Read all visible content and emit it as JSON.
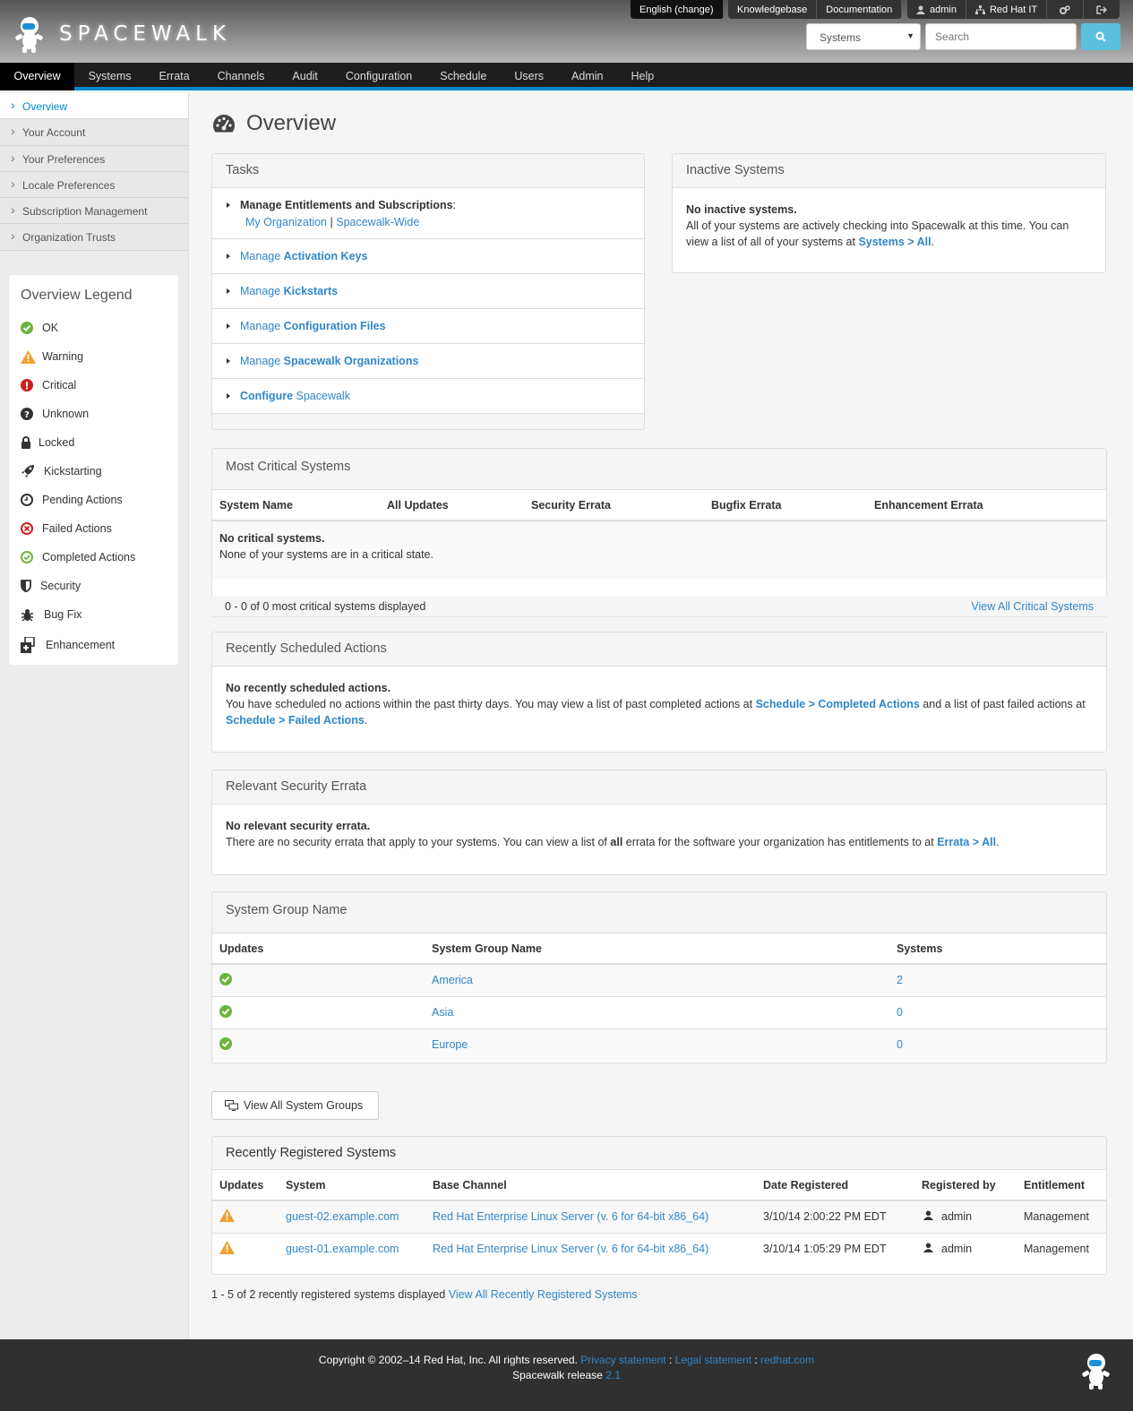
{
  "app": {
    "name": "SPACEWALK"
  },
  "utility": {
    "language": "English (change)",
    "knowledgebase": "Knowledgebase",
    "documentation": "Documentation",
    "user": "admin",
    "org": "Red Hat IT"
  },
  "search": {
    "scope": "Systems",
    "placeholder": "Search"
  },
  "nav": [
    "Overview",
    "Systems",
    "Errata",
    "Channels",
    "Audit",
    "Configuration",
    "Schedule",
    "Users",
    "Admin",
    "Help"
  ],
  "sidebar": [
    "Overview",
    "Your Account",
    "Your Preferences",
    "Locale Preferences",
    "Subscription Management",
    "Organization Trusts"
  ],
  "legend": {
    "title": "Overview Legend",
    "items": [
      "OK",
      "Warning",
      "Critical",
      "Unknown",
      "Locked",
      "Kickstarting",
      "Pending Actions",
      "Failed Actions",
      "Completed Actions",
      "Security",
      "Bug Fix",
      "Enhancement"
    ]
  },
  "page": {
    "title": "Overview"
  },
  "tasks": {
    "title": "Tasks",
    "t1": {
      "bold": "Manage Entitlements and Subscriptions",
      "suffix": ":",
      "link1": "My Organization",
      "sep": "|",
      "link2": "Spacewalk-Wide"
    },
    "t2": {
      "pre": "Manage ",
      "bold": "Activation Keys"
    },
    "t3": {
      "pre": "Manage ",
      "bold": "Kickstarts"
    },
    "t4": {
      "pre": "Manage ",
      "bold": "Configuration Files"
    },
    "t5": {
      "pre": "Manage ",
      "bold": "Spacewalk Organizations"
    },
    "t6": {
      "bold": "Configure",
      "post": " Spacewalk"
    }
  },
  "inactive": {
    "title": "Inactive Systems",
    "heading": "No inactive systems.",
    "text": "All of your systems are actively checking into Spacewalk at this time. You can view a list of all of your systems at ",
    "link": "Systems > All",
    "end": "."
  },
  "critical": {
    "title": "Most Critical Systems",
    "columns": [
      "System Name",
      "All Updates",
      "Security Errata",
      "Bugfix Errata",
      "Enhancement Errata"
    ],
    "empty_heading": "No critical systems.",
    "empty_text": "None of your systems are in a critical state.",
    "footer": "0 - 0 of 0 most critical systems displayed",
    "view_all": "View All Critical Systems"
  },
  "scheduled": {
    "title": "Recently Scheduled Actions",
    "heading": "No recently scheduled actions.",
    "text1": "You have scheduled no actions within the past thirty days. You may view a list of past completed actions at ",
    "link1": "Schedule > Completed Actions",
    "text2": " and a list of past failed actions at ",
    "link2": "Schedule > Failed Actions",
    "end": "."
  },
  "security": {
    "title": "Relevant Security Errata",
    "heading": "No relevant security errata.",
    "text1": "There are no security errata that apply to your systems. You can view a list of ",
    "bold": "all",
    "text2": " errata for the software your organization has entitlements to at ",
    "link": "Errata > All",
    "end": "."
  },
  "groups": {
    "title": "System Group Name",
    "columns": [
      "Updates",
      "System Group Name",
      "Systems"
    ],
    "rows": [
      {
        "name": "America",
        "systems": "2"
      },
      {
        "name": "Asia",
        "systems": "0"
      },
      {
        "name": "Europe",
        "systems": "0"
      }
    ],
    "button": "View All System Groups"
  },
  "registered": {
    "title": "Recently Registered Systems",
    "columns": [
      "Updates",
      "System",
      "Base Channel",
      "Date Registered",
      "Registered by",
      "Entitlement"
    ],
    "rows": [
      {
        "system": "guest-02.example.com",
        "channel": "Red Hat Enterprise Linux Server (v. 6 for 64-bit x86_64)",
        "date": "3/10/14 2:00:22 PM EDT",
        "by": "admin",
        "entitlement": "Management"
      },
      {
        "system": "guest-01.example.com",
        "channel": "Red Hat Enterprise Linux Server (v. 6 for 64-bit x86_64)",
        "date": "3/10/14 1:05:29 PM EDT",
        "by": "admin",
        "entitlement": "Management"
      }
    ],
    "footer": "1 - 5 of 2 recently registered systems displayed ",
    "view_all": "View All Recently Registered Systems"
  },
  "footer": {
    "copyright": "Copyright © 2002–14 Red Hat, Inc. All rights reserved. ",
    "privacy": "Privacy statement",
    "sep1": " : ",
    "legal": "Legal statement",
    "sep2": " : ",
    "redhat": "redhat.com",
    "release": "Spacewalk release ",
    "version": "2.1"
  },
  "colors": {
    "accent": "#0088ce",
    "link": "#2f86c9",
    "ok": "#6cb33e",
    "warning": "#f0a030",
    "critical": "#cc1f1f"
  }
}
